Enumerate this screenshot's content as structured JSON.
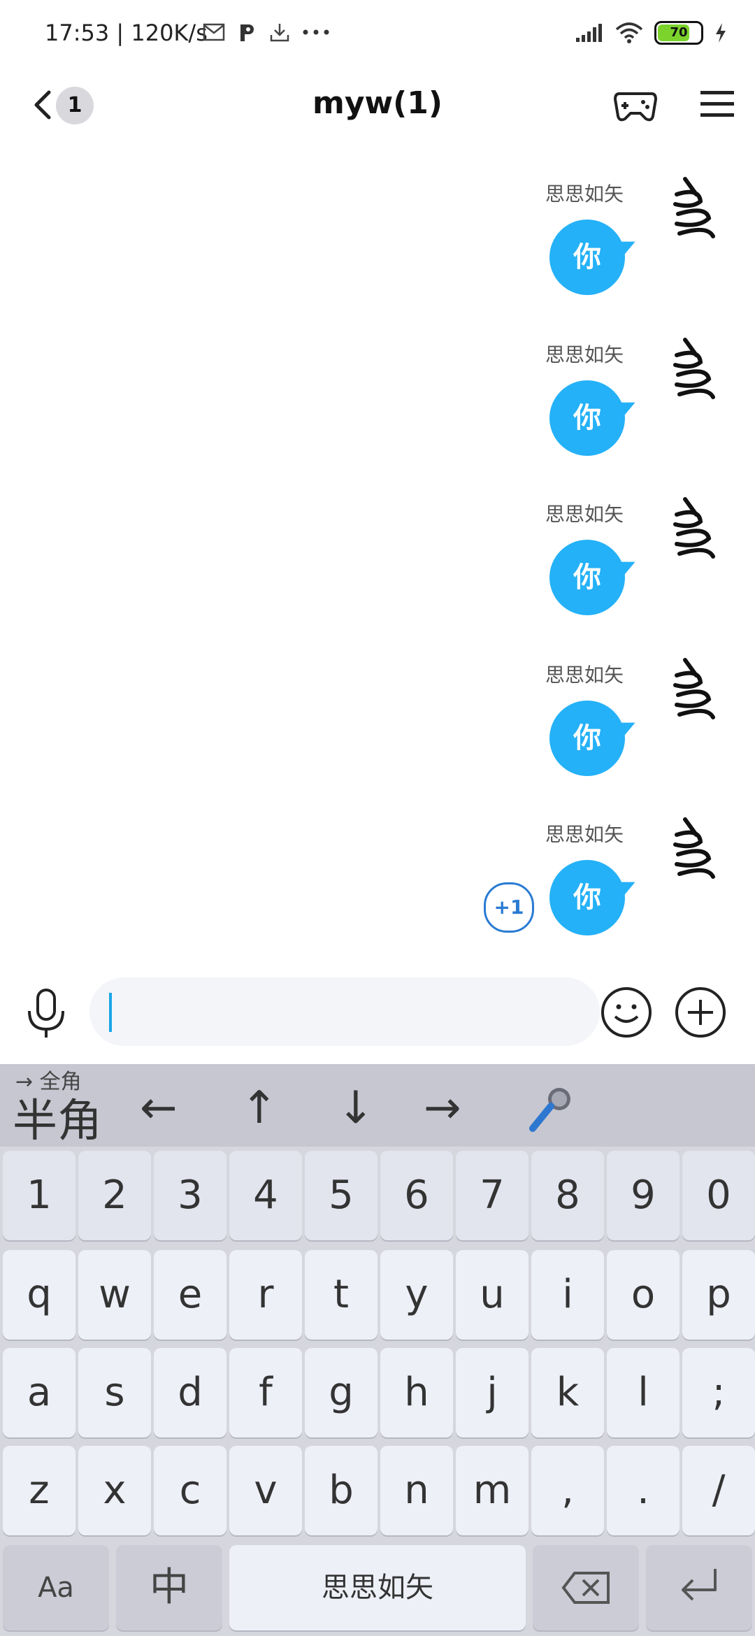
{
  "status_bar": {
    "time": "17:53 | 120K/s",
    "battery": "70",
    "left_icons": [
      "mail-icon",
      "p-icon",
      "download-icon",
      "more-icon"
    ],
    "right_icons": [
      "signal-icon",
      "wifi-icon",
      "battery-icon",
      "charging-icon"
    ]
  },
  "header": {
    "unread_count": "1",
    "title": "myw(1)"
  },
  "messages": [
    {
      "sender": "思思如矢",
      "text": "你"
    },
    {
      "sender": "思思如矢",
      "text": "你"
    },
    {
      "sender": "思思如矢",
      "text": "你"
    },
    {
      "sender": "思思如矢",
      "text": "你"
    },
    {
      "sender": "思思如矢",
      "text": "你"
    }
  ],
  "plus_one": "+1",
  "input": {
    "placeholder": ""
  },
  "keyboard": {
    "fullwidth_hint": "→ 全角",
    "halfwidth_label": "半角",
    "arrows": [
      "←",
      "↑",
      "↓",
      "→"
    ],
    "number_row": [
      "1",
      "2",
      "3",
      "4",
      "5",
      "6",
      "7",
      "8",
      "9",
      "0"
    ],
    "row1": [
      "q",
      "w",
      "e",
      "r",
      "t",
      "y",
      "u",
      "i",
      "o",
      "p"
    ],
    "row2": [
      "a",
      "s",
      "d",
      "f",
      "g",
      "h",
      "j",
      "k",
      "l",
      ";"
    ],
    "row3": [
      "z",
      "x",
      "c",
      "v",
      "b",
      "n",
      "m",
      ",",
      ".",
      "/"
    ],
    "bottom": {
      "case_key": "Aa",
      "lang_key": "中",
      "space_label": "思思如矢"
    }
  },
  "colors": {
    "bubble": "#24b1f8",
    "keyboard_bg": "#d5d6de",
    "key_bg": "#eef0f8"
  }
}
